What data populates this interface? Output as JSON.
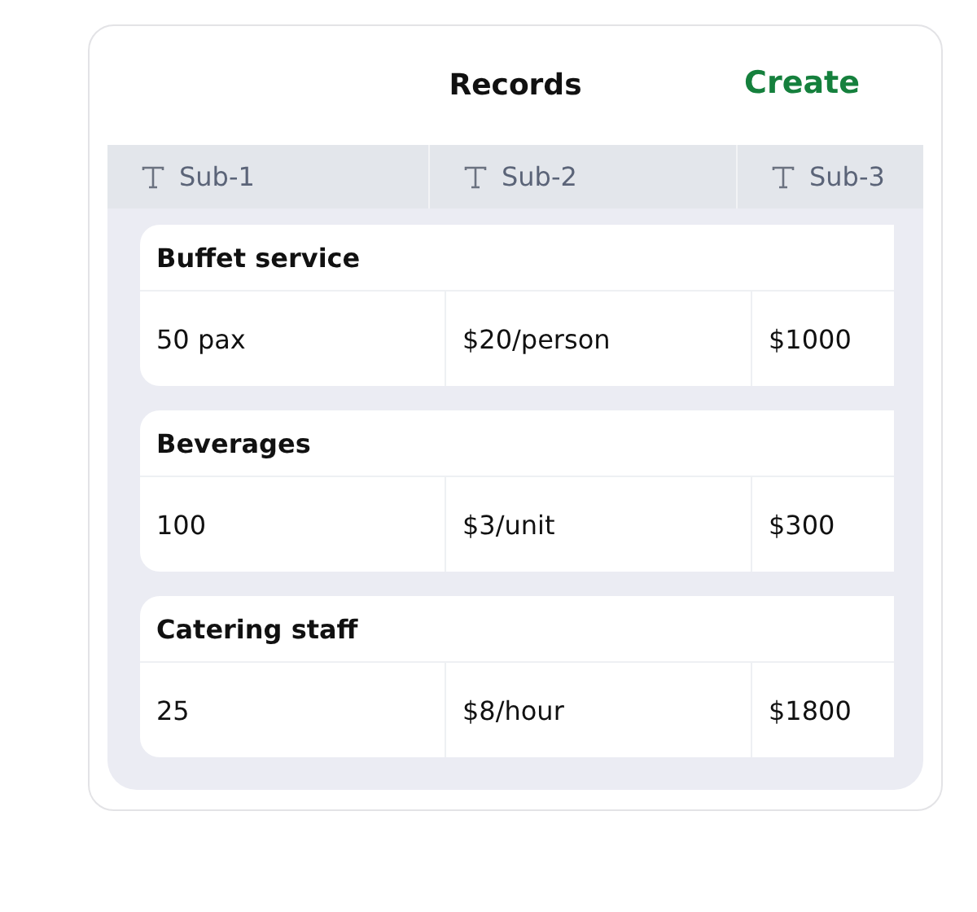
{
  "header": {
    "title": "Records",
    "action": "Create"
  },
  "columns": [
    "Sub-1",
    "Sub-2",
    "Sub-3"
  ],
  "records": [
    {
      "title": "Buffet service",
      "cells": [
        "50 pax",
        "$20/person",
        "$1000"
      ]
    },
    {
      "title": "Beverages",
      "cells": [
        "100",
        "$3/unit",
        "$300"
      ]
    },
    {
      "title": "Catering staff",
      "cells": [
        "25",
        "$8/hour",
        "$1800"
      ]
    }
  ]
}
